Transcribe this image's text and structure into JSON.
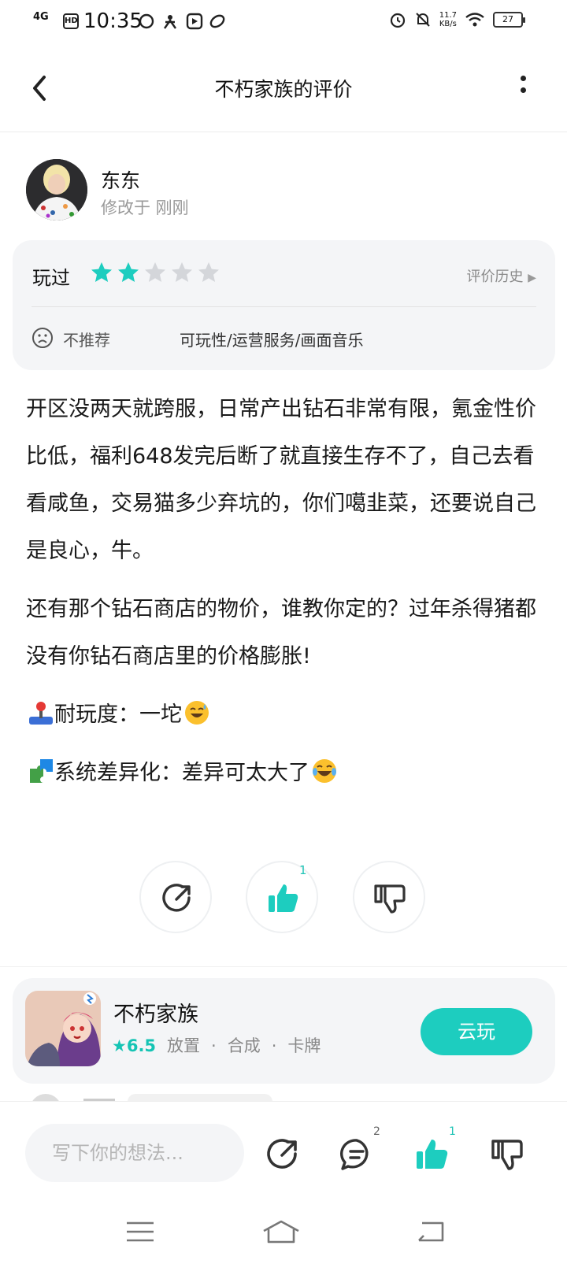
{
  "status_bar": {
    "signal": "4G",
    "hd": "HD",
    "time": "10:35",
    "net_speed_value": "11.7",
    "net_speed_unit": "KB/s",
    "battery": "27"
  },
  "header": {
    "title": "不朽家族的评价"
  },
  "author": {
    "name": "东东",
    "modified": "修改于 刚刚"
  },
  "rating_card": {
    "played_label": "玩过",
    "rating": 2,
    "max_rating": 5,
    "history_label": "评价历史",
    "recommend_label": "不推荐",
    "tags": "可玩性/运营服务/画面音乐"
  },
  "review": {
    "p1": "开区没两天就跨服，日常产出钻石非常有限，氪金性价比低，福利648发完后断了就直接生存不了，自己去看看咸鱼，交易猫多少弃坑的，你们噶韭菜，还要说自己是良心，牛。",
    "p2": "还有那个钻石商店的物价，谁教你定的？过年杀得猪都没有你钻石商店里的价格膨胀!",
    "p3": "耐玩度：一坨",
    "p4": "系统差异化：差异可太大了"
  },
  "actions": {
    "like_count": "1"
  },
  "game": {
    "name": "不朽家族",
    "score": "6.5",
    "tags": [
      "放置",
      "合成",
      "卡牌"
    ],
    "play_label": "云玩"
  },
  "bottom_bar": {
    "placeholder": "写下你的想法...",
    "comment_count": "2",
    "like_count": "1"
  },
  "colors": {
    "accent": "#1dcdbf",
    "star_off": "#d4d6da"
  }
}
